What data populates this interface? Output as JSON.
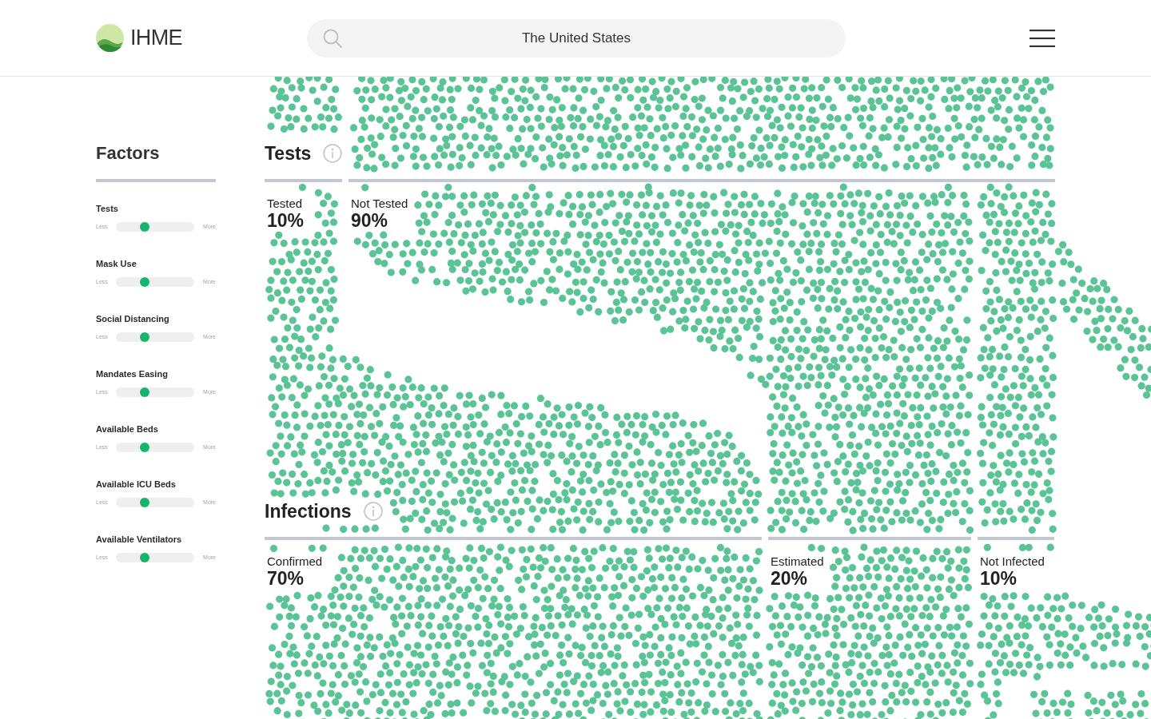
{
  "header": {
    "logo_text": "IHME",
    "search": {
      "value": "The United States"
    }
  },
  "sidebar": {
    "title": "Factors",
    "factors": [
      {
        "label": "Tests",
        "min_label": "Less",
        "max_label": "More",
        "level": 0.34
      },
      {
        "label": "Mask Use",
        "min_label": "Less",
        "max_label": "More",
        "level": 0.34
      },
      {
        "label": "Social Distancing",
        "min_label": "Less",
        "max_label": "More",
        "level": 0.34
      },
      {
        "label": "Mandates Easing",
        "min_label": "Less",
        "max_label": "More",
        "level": 0.34
      },
      {
        "label": "Available Beds",
        "min_label": "Less",
        "max_label": "More",
        "level": 0.34
      },
      {
        "label": "Available ICU Beds",
        "min_label": "Less",
        "max_label": "More",
        "level": 0.34
      },
      {
        "label": "Available Ventilators",
        "min_label": "Less",
        "max_label": "More",
        "level": 0.34
      }
    ]
  },
  "sections": [
    {
      "title": "Tests",
      "groups": [
        {
          "label": "Tested",
          "value": "10%"
        },
        {
          "label": "Not Tested",
          "value": "90%"
        }
      ]
    },
    {
      "title": "Infections",
      "groups": [
        {
          "label": "Confirmed",
          "value": "70%"
        },
        {
          "label": "Estimated",
          "value": "20%"
        },
        {
          "label": "Not Infected",
          "value": "10%"
        }
      ]
    }
  ]
}
